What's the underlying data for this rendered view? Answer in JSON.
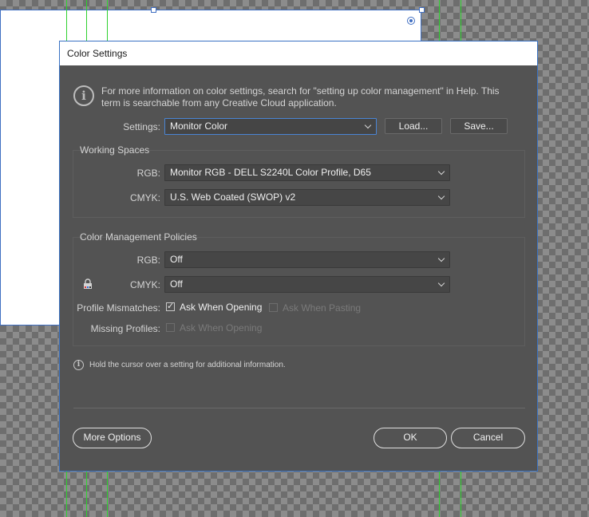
{
  "dialog": {
    "title": "Color Settings"
  },
  "info": {
    "text": "For more information on color settings, search for \"setting up color management\" in Help. This term is searchable from any Creative Cloud application."
  },
  "settings": {
    "label": "Settings:",
    "value": "Monitor Color",
    "load_label": "Load...",
    "save_label": "Save..."
  },
  "working_spaces": {
    "title": "Working Spaces",
    "rgb_label": "RGB:",
    "rgb_value": "Monitor RGB - DELL S2240L Color Profile, D65",
    "cmyk_label": "CMYK:",
    "cmyk_value": "U.S. Web Coated (SWOP) v2"
  },
  "policies": {
    "title": "Color Management Policies",
    "rgb_label": "RGB:",
    "rgb_value": "Off",
    "cmyk_label": "CMYK:",
    "cmyk_value": "Off",
    "mismatch_label": "Profile Mismatches:",
    "ask_opening_label": "Ask When Opening",
    "ask_opening_checked": true,
    "ask_pasting_label": "Ask When Pasting",
    "ask_pasting_checked": false,
    "missing_label": "Missing Profiles:",
    "missing_ask_opening_label": "Ask When Opening",
    "missing_ask_opening_checked": false
  },
  "hint": {
    "text": "Hold the cursor over a setting for additional information."
  },
  "footer": {
    "more_options_label": "More Options",
    "ok_label": "OK",
    "cancel_label": "Cancel"
  },
  "colors": {
    "dialog_bg": "#535353",
    "field_bg": "#464646",
    "accent_border": "#3a73c4",
    "guide": "#2fd12f"
  }
}
